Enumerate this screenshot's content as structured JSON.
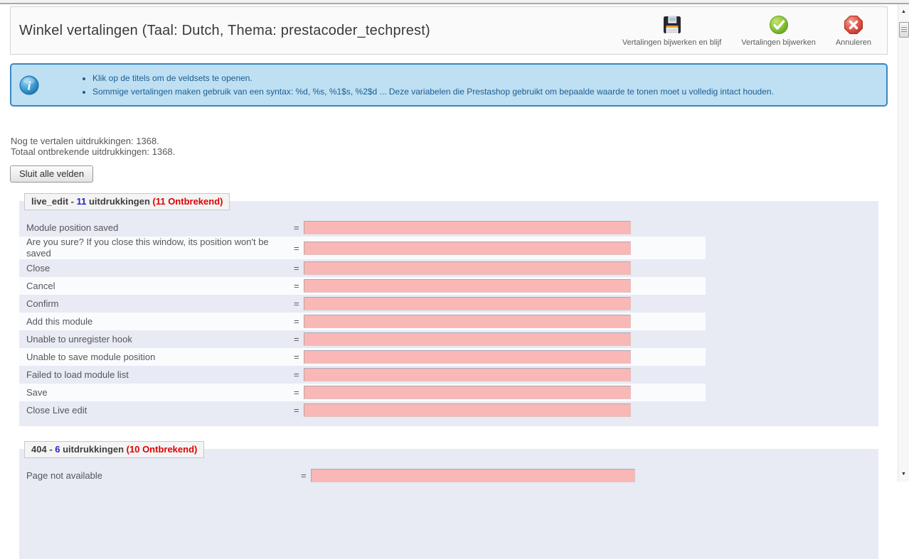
{
  "header": {
    "title": "Winkel vertalingen (Taal: Dutch, Thema: prestacoder_techprest)",
    "buttons": [
      {
        "icon": "floppy-disk-icon",
        "label": "Vertalingen bijwerken en blijf"
      },
      {
        "icon": "check-circle-icon",
        "label": "Vertalingen bijwerken"
      },
      {
        "icon": "cancel-octagon-icon",
        "label": "Annuleren"
      }
    ]
  },
  "info": {
    "icon": "info-icon",
    "bullets": [
      "Klik op de titels om de veldsets te openen.",
      "Sommige vertalingen maken gebruik van een syntax: %d, %s, %1$s, %2$d ... Deze variabelen die Prestashop gebruikt om bepaalde waarde te tonen moet u volledig intact houden."
    ]
  },
  "stats": {
    "line1": "Nog te vertalen uitdrukkingen: 1368.",
    "line2": "Totaal ontbrekende uitdrukkingen: 1368."
  },
  "controls": {
    "close_all": "Sluit alle velden"
  },
  "ui": {
    "equals": "=",
    "scroll_up": "▲",
    "scroll_down": "▼"
  },
  "fieldsets": [
    {
      "name": "live_edit",
      "sep": " - ",
      "count": "11",
      "unit": " uitdrukkingen ",
      "missing": "(11 Ontbrekend)",
      "rows": [
        "Module position saved",
        "Are you sure? If you close this window, its position won't be saved",
        "Close",
        "Cancel",
        "Confirm",
        "Add this module",
        "Unable to unregister hook",
        "Unable to save module position",
        "Failed to load module list",
        "Save",
        "Close Live edit"
      ]
    },
    {
      "name": "404",
      "sep": " - ",
      "count": "6",
      "unit": " uitdrukkingen ",
      "missing": "(10 Ontbrekend)",
      "rows": [
        "Page not available"
      ]
    }
  ],
  "colors": {
    "missing_field": "#f9b7b5",
    "fieldset_bg": "#e8eaf4",
    "count_blue": "#2323cc",
    "missing_red": "#e00000",
    "info_bg": "#bfe0f2",
    "info_border": "#3a86c0",
    "info_text": "#1c5c92"
  }
}
